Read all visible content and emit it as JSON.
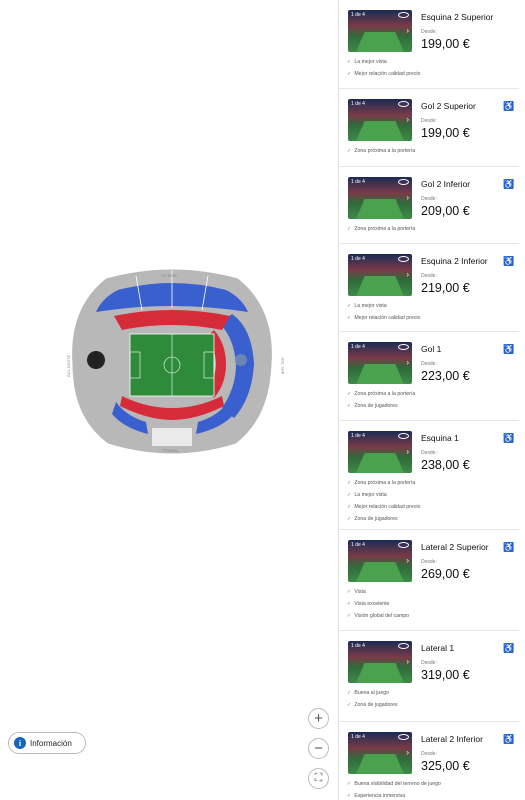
{
  "map": {
    "stand_labels": {
      "top": "LATERAL",
      "left": "GOL NORTE",
      "right": "GOL SUR",
      "bottom": "TRIBUNA"
    },
    "zoom_in": "+",
    "zoom_out": "−",
    "fullscreen": "⛶",
    "info_label": "Información",
    "info_icon": "i"
  },
  "colors": {
    "upper_tier": "#3a5fcf",
    "lower_tier": "#d62c3a",
    "pitch": "#2e8b3a",
    "stand": "#b8b8b8"
  },
  "cards": [
    {
      "tag": "1 de 4",
      "name": "Esquina 2 Superior",
      "desde": "Desde:",
      "price": "199,00 €",
      "features": [
        "La mejor vista",
        "Mejor relación calidad precio"
      ]
    },
    {
      "tag": "1 de 4",
      "name": "Gol 2 Superior",
      "desde": "Desde:",
      "price": "199,00 €",
      "features": [
        "Zona próxima a la portería"
      ]
    },
    {
      "tag": "1 de 4",
      "name": "Gol 2 Inferior",
      "desde": "Desde:",
      "price": "209,00 €",
      "features": [
        "Zona próxima a la portería"
      ]
    },
    {
      "tag": "1 de 4",
      "name": "Esquina 2 Inferior",
      "desde": "Desde:",
      "price": "219,00 €",
      "features": [
        "La mejor vista",
        "Mejor relación calidad precio"
      ]
    },
    {
      "tag": "1 de 4",
      "name": "Gol 1",
      "desde": "Desde:",
      "price": "223,00 €",
      "features": [
        "Zona próxima a la portería",
        "Zona de jugadores"
      ]
    },
    {
      "tag": "1 de 4",
      "name": "Esquina 1",
      "desde": "Desde:",
      "price": "238,00 €",
      "features": [
        "Zona próxima a la portería",
        "La mejor vista",
        "Mejor relación calidad precio",
        "Zona de jugadores"
      ]
    },
    {
      "tag": "1 de 4",
      "name": "Lateral 2 Superior",
      "desde": "Desde:",
      "price": "269,00 €",
      "features": [
        "Vista",
        "Vista excelente",
        "Visión global del campo"
      ]
    },
    {
      "tag": "1 de 4",
      "name": "Lateral 1",
      "desde": "Desde:",
      "price": "319,00 €",
      "features": [
        "Buena al juego",
        "Zona de jugadores"
      ]
    },
    {
      "tag": "1 de 4",
      "name": "Lateral 2 Inferior",
      "desde": "Desde:",
      "price": "325,00 €",
      "features": [
        "Buena visibilidad del terreno de juego",
        "Experiencia inmersiva"
      ]
    }
  ]
}
